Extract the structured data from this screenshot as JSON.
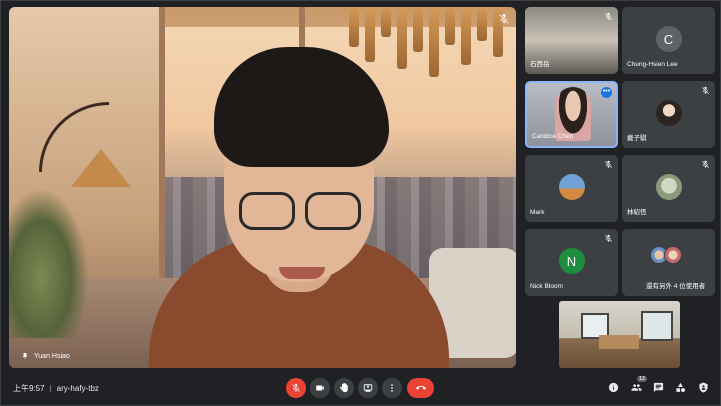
{
  "main": {
    "speaker_name": "Yuan Hsiao"
  },
  "participants": [
    {
      "name": "石西岳",
      "mic": "muted"
    },
    {
      "name": "Chung-Hsien Lee",
      "avatar_letter": "C",
      "avatar_color": "#5f6368"
    },
    {
      "name": "Candice Chen",
      "active": true
    },
    {
      "name": "戴子騏",
      "mic": "muted"
    },
    {
      "name": "Mark",
      "mic": "muted"
    },
    {
      "name": "林紹恆",
      "mic": "muted"
    },
    {
      "name": "Nick Bloom",
      "avatar_letter": "N",
      "avatar_color": "#1e8e3e",
      "mic": "muted"
    },
    {
      "name": "還有另外 4 位使用者"
    }
  ],
  "bottom_bar": {
    "time": "上午9:57",
    "meeting_code": "ary-hafy-tbz",
    "participant_count": "12"
  },
  "icons": {
    "mic_off": "mic-off-icon",
    "camera": "camera-icon",
    "raise_hand": "raise-hand-icon",
    "present": "present-screen-icon",
    "more": "more-options-icon",
    "end_call": "end-call-icon",
    "info": "info-icon",
    "people": "people-icon",
    "chat": "chat-icon",
    "activities": "activities-icon",
    "host_controls": "host-controls-icon"
  },
  "colors": {
    "background": "#202124",
    "tile": "#3c4043",
    "accent": "#8ab4f8",
    "danger": "#ea4335"
  }
}
